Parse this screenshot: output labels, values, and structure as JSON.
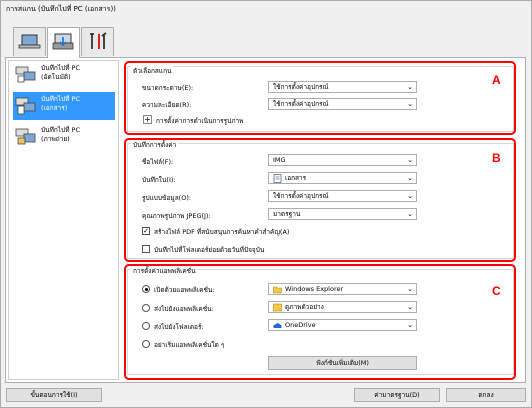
{
  "window": {
    "title": "การสแกน (บันทึกไปที่ PC (เอกสาร))"
  },
  "tabs": [
    {
      "icon": "scan-from-computer-icon",
      "label": ""
    },
    {
      "icon": "scan-from-operation-panel-icon",
      "label": ""
    },
    {
      "icon": "general-settings-tools-icon",
      "label": ""
    }
  ],
  "sidebar": {
    "items": [
      {
        "label_1": "บันทึกไปที่ PC",
        "label_2": "(อัตโนมัติ)",
        "icon": "auto-scan-icon"
      },
      {
        "label_1": "บันทึกไปที่ PC",
        "label_2": "(เอกสาร)",
        "icon": "document-scan-icon"
      },
      {
        "label_1": "บันทึกไปที่ PC",
        "label_2": "(ภาพถ่าย)",
        "icon": "photo-scan-icon"
      }
    ]
  },
  "scan_options": {
    "title": "ตัวเลือกสแกน",
    "badge": "A",
    "paper_size_label": "ขนาดกระดาษ(E):",
    "paper_size_value": "ใช้การตั้งค่าอุปกรณ์",
    "resolution_label": "ความละเอียด(R):",
    "resolution_value": "ใช้การตั้งค่าอุปกรณ์",
    "image_processing_label": "การตั้งค่าการดำเนินการรูปภาพ"
  },
  "save_settings": {
    "title": "บันทึกการตั้งค่า",
    "badge": "B",
    "file_name_label": "ชื่อไฟล์(F):",
    "file_name_value": "IMG",
    "save_in_label": "บันทึกใน(I):",
    "save_in_value": "เอกสาร",
    "data_format_label": "รูปแบบข้อมูล(O):",
    "data_format_value": "ใช้การตั้งค่าอุปกรณ์",
    "jpeg_quality_label": "คุณภาพรูปภาพ JPEG(J):",
    "jpeg_quality_value": "มาตรฐาน",
    "create_pdf_label": "สร้างไฟล์ PDF ที่สนับสนุนการค้นหาคำสำคัญ(A)",
    "create_pdf_checked": "✓",
    "subfolder_label": "บันทึกไปที่โฟลเดอร์ย่อยด้วยวันที่ปัจจุบัน"
  },
  "app_settings": {
    "title": "การตั้งค่าแอพพลิเคชั่น",
    "badge": "C",
    "open_app_label": "เปิดด้วยแอพพลิเคชั่น:",
    "open_app_value": "Windows Explorer",
    "send_app_label": "ส่งไปยังแอพพลิเคชั่น:",
    "send_app_value": "ดูภาพตัวอย่าง",
    "send_folder_label": "ส่งไปยังโฟลเดอร์:",
    "send_folder_value": "OneDrive",
    "no_app_label": "อย่าเริ่มแอพพลิเคชั่นใด ๆ",
    "more_functions_button": "ฟังก์ชันเพิ่มเติม(M)"
  },
  "footer": {
    "instructions_button": "ขั้นตอนการใช้(I)",
    "defaults_button": "ค่ามาตรฐาน(D)",
    "ok_button": "ตกลง"
  },
  "colors": {
    "highlight_red": "#ff0000",
    "selection_blue": "#3399ff"
  }
}
